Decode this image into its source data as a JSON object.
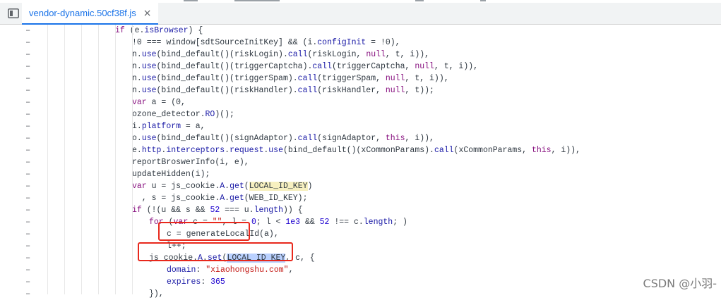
{
  "tab": {
    "title": "vendor-dynamic.50cf38f.js",
    "close": "×"
  },
  "icons": {
    "panel_toggle": "sidebar-toggle-icon",
    "close": "close-icon"
  },
  "gutter_mark": "–",
  "code_lines": [
    [
      [
        "kw",
        "if"
      ],
      [
        "t",
        " (e."
      ],
      [
        "prop",
        "isBrowser"
      ],
      [
        "t",
        ") {"
      ]
    ],
    [
      [
        "t",
        "!0 "
      ],
      [
        "t",
        "=== window[sdtSourceInitKey] && (i."
      ],
      [
        "prop",
        "configInit"
      ],
      [
        "t",
        " = !0),"
      ]
    ],
    [
      [
        "t",
        "n."
      ],
      [
        "fn",
        "use"
      ],
      [
        "t",
        "(bind_default()(riskLogin)."
      ],
      [
        "fn",
        "call"
      ],
      [
        "t",
        "(riskLogin, "
      ],
      [
        "kw",
        "null"
      ],
      [
        "t",
        ", t, i)),"
      ]
    ],
    [
      [
        "t",
        "n."
      ],
      [
        "fn",
        "use"
      ],
      [
        "t",
        "(bind_default()(triggerCaptcha)."
      ],
      [
        "fn",
        "call"
      ],
      [
        "t",
        "(triggerCaptcha, "
      ],
      [
        "kw",
        "null"
      ],
      [
        "t",
        ", t, i)),"
      ]
    ],
    [
      [
        "t",
        "n."
      ],
      [
        "fn",
        "use"
      ],
      [
        "t",
        "(bind_default()(triggerSpam)."
      ],
      [
        "fn",
        "call"
      ],
      [
        "t",
        "(triggerSpam, "
      ],
      [
        "kw",
        "null"
      ],
      [
        "t",
        ", t, i)),"
      ]
    ],
    [
      [
        "t",
        "n."
      ],
      [
        "fn",
        "use"
      ],
      [
        "t",
        "(bind_default()(riskHandler)."
      ],
      [
        "fn",
        "call"
      ],
      [
        "t",
        "(riskHandler, "
      ],
      [
        "kw",
        "null"
      ],
      [
        "t",
        ", t));"
      ]
    ],
    [
      [
        "kw",
        "var"
      ],
      [
        "t",
        " a = (0,"
      ]
    ],
    [
      [
        "t",
        "ozone_detector."
      ],
      [
        "fn",
        "RO"
      ],
      [
        "t",
        ")();"
      ]
    ],
    [
      [
        "t",
        "i."
      ],
      [
        "prop",
        "platform"
      ],
      [
        "t",
        " = a,"
      ]
    ],
    [
      [
        "t",
        "o."
      ],
      [
        "fn",
        "use"
      ],
      [
        "t",
        "(bind_default()(signAdaptor)."
      ],
      [
        "fn",
        "call"
      ],
      [
        "t",
        "(signAdaptor, "
      ],
      [
        "kw",
        "this"
      ],
      [
        "t",
        ", i)),"
      ]
    ],
    [
      [
        "t",
        "e."
      ],
      [
        "prop",
        "http"
      ],
      [
        "t",
        "."
      ],
      [
        "prop",
        "interceptors"
      ],
      [
        "t",
        "."
      ],
      [
        "prop",
        "request"
      ],
      [
        "t",
        "."
      ],
      [
        "fn",
        "use"
      ],
      [
        "t",
        "(bind_default()(xCommonParams)."
      ],
      [
        "fn",
        "call"
      ],
      [
        "t",
        "(xCommonParams, "
      ],
      [
        "kw",
        "this"
      ],
      [
        "t",
        ", i)),"
      ]
    ],
    [
      [
        "t",
        "reportBroswerInfo(i, e),"
      ]
    ],
    [
      [
        "t",
        "updateHidden(i);"
      ]
    ],
    [
      [
        "kw",
        "var"
      ],
      [
        "t",
        " u = js_cookie."
      ],
      [
        "fn",
        "A"
      ],
      [
        "t",
        "."
      ],
      [
        "fn",
        "get"
      ],
      [
        "t",
        "("
      ],
      [
        "hy",
        "LOCAL_ID_KEY"
      ],
      [
        "t",
        ")"
      ]
    ],
    [
      [
        "t",
        "  , s = js_cookie."
      ],
      [
        "fn",
        "A"
      ],
      [
        "t",
        "."
      ],
      [
        "fn",
        "get"
      ],
      [
        "t",
        "(WEB_ID_KEY);"
      ]
    ],
    [
      [
        "kw",
        "if"
      ],
      [
        "t",
        " (!(u && s && "
      ],
      [
        "num",
        "52"
      ],
      [
        "t",
        " === u."
      ],
      [
        "prop",
        "length"
      ],
      [
        "t",
        ")) {"
      ]
    ],
    [
      [
        "kw",
        "for"
      ],
      [
        "t",
        " ("
      ],
      [
        "kw",
        "var"
      ],
      [
        "t",
        " c = "
      ],
      [
        "str",
        "\"\""
      ],
      [
        "t",
        ", l = "
      ],
      [
        "num",
        "0"
      ],
      [
        "t",
        "; l < "
      ],
      [
        "num",
        "1e3"
      ],
      [
        "t",
        " && "
      ],
      [
        "num",
        "52"
      ],
      [
        "t",
        " !== c."
      ],
      [
        "prop",
        "length"
      ],
      [
        "t",
        "; )"
      ]
    ],
    [
      [
        "t",
        "c = generateLocalId(a),"
      ]
    ],
    [
      [
        "t",
        "l++;"
      ]
    ],
    [
      [
        "t",
        "js_cookie."
      ],
      [
        "fn",
        "A"
      ],
      [
        "t",
        "."
      ],
      [
        "fn",
        "set"
      ],
      [
        "t",
        "("
      ],
      [
        "hb",
        "LOCAL_ID_KEY"
      ],
      [
        "t",
        ", c, {"
      ]
    ],
    [
      [
        "prop",
        "domain"
      ],
      [
        "t",
        ": "
      ],
      [
        "str",
        "\"xiaohongshu.com\""
      ],
      [
        "t",
        ","
      ]
    ],
    [
      [
        "prop",
        "expires"
      ],
      [
        "t",
        ": "
      ],
      [
        "num",
        "365"
      ]
    ],
    [
      [
        "t",
        "}),"
      ]
    ]
  ],
  "watermark": "CSDN @小羽-"
}
